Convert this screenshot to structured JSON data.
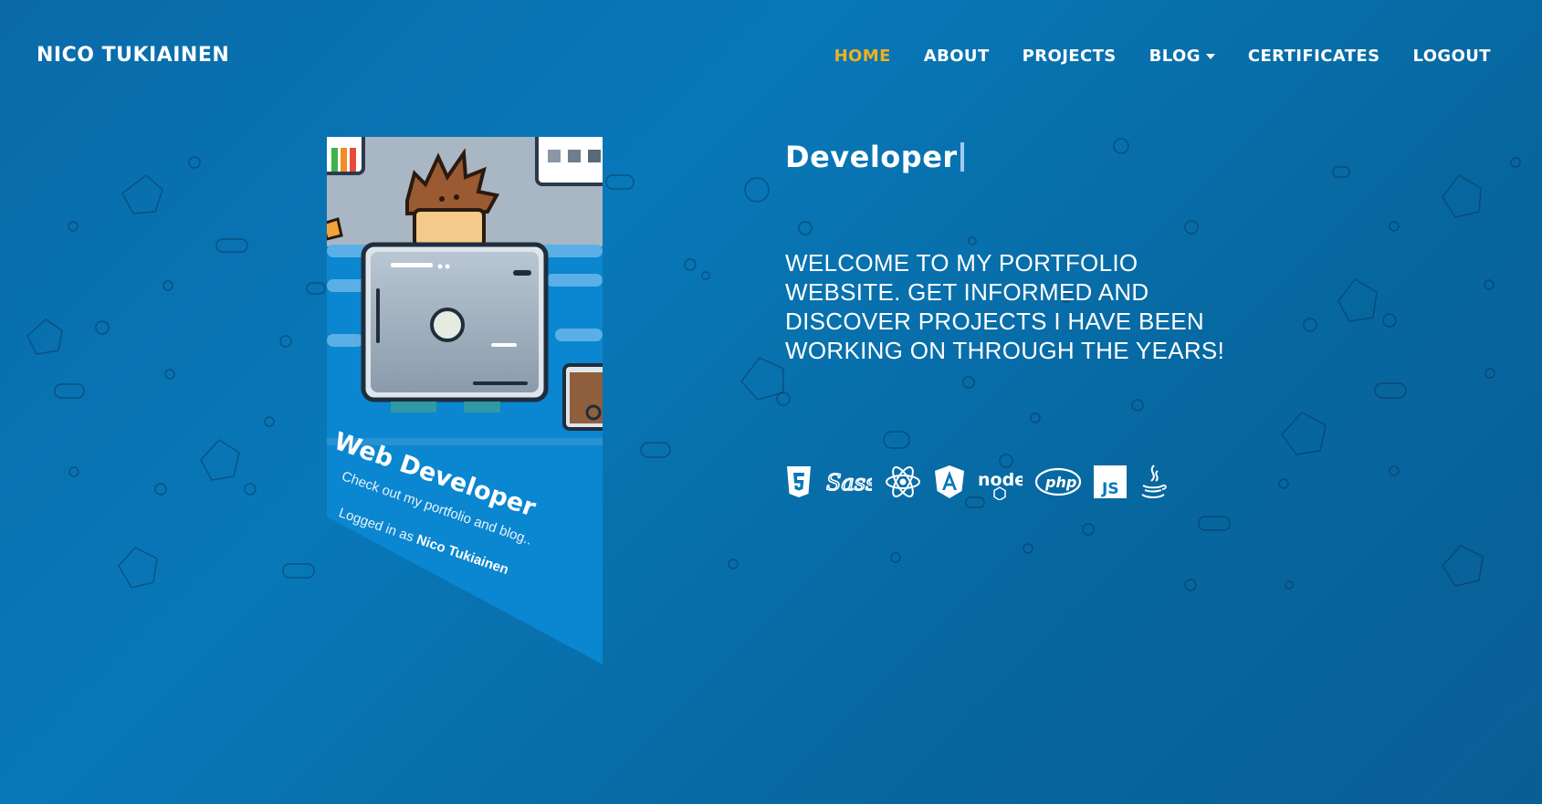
{
  "brand": "NICO TUKIAINEN",
  "nav": {
    "home": "HOME",
    "about": "ABOUT",
    "projects": "PROJECTS",
    "blog": "BLOG",
    "certificates": "CERTIFICATES",
    "logout": "LOGOUT"
  },
  "colors": {
    "active_nav": "#f2b01e",
    "accent_blue": "#0b86d0",
    "background": "#0878b8"
  },
  "card": {
    "title": "Web Developer",
    "subtitle": "Check out my portfolio and blog..",
    "login_prefix": "Logged in as",
    "login_name": "Nico Tukiainen"
  },
  "hero": {
    "typed": "Developer",
    "welcome": "WELCOME TO MY PORTFOLIO WEBSITE. GET INFORMED AND DISCOVER PROJECTS I HAVE BEEN WORKING ON THROUGH THE YEARS!"
  },
  "tech_icons": {
    "html5": "html5-icon",
    "sass": "sass-icon",
    "react": "react-icon",
    "angular": "angular-icon",
    "node": "node-icon",
    "php": "php-icon",
    "js": "js-icon",
    "java": "java-icon",
    "sass_text": "Sass",
    "node_text": "node",
    "php_text": "php",
    "js_text": "JS"
  }
}
